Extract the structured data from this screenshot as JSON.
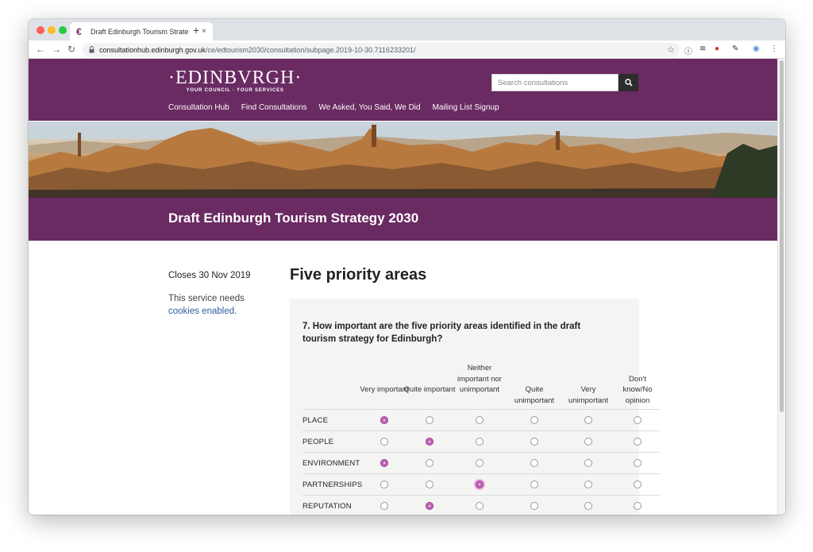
{
  "browser": {
    "tab_title": "Draft Edinburgh Tourism Strate",
    "tab_close": "×",
    "new_tab": "+",
    "url_host": "consultationhub.edinburgh.gov.uk",
    "url_path": "/ce/edtourism2030/consultation/subpage.2019-10-30.7116233201/"
  },
  "header": {
    "logo": "·EDINBVRGH·",
    "logo_tagline": "YOUR COUNCIL · YOUR SERVICES",
    "search_placeholder": "Search consultations",
    "nav": [
      "Consultation Hub",
      "Find Consultations",
      "We Asked, You Said, We Did",
      "Mailing List Signup"
    ]
  },
  "title_bar": {
    "title": "Draft Edinburgh Tourism Strategy 2030"
  },
  "sidebar": {
    "closes": "Closes 30 Nov 2019",
    "cookies_prefix": "This service needs",
    "cookies_link": "cookies enabled",
    "cookies_suffix": "."
  },
  "main": {
    "section_title": "Five priority areas",
    "question": "7. How important are the five priority areas identified in the draft tourism strategy for Edinburgh?",
    "columns": [
      "Very important",
      "Quite important",
      "Neither important nor unimportant",
      "Quite unimportant",
      "Very unimportant",
      "Don't know/No opinion"
    ],
    "rows": [
      {
        "label": "PLACE",
        "selected": 0
      },
      {
        "label": "PEOPLE",
        "selected": 1
      },
      {
        "label": "ENVIRONMENT",
        "selected": 0
      },
      {
        "label": "PARTNERSHIPS",
        "selected": 2
      },
      {
        "label": "REPUTATION",
        "selected": 1
      }
    ]
  },
  "colors": {
    "brand_purple": "#6a2a62",
    "radio_selected": "#b257a8"
  }
}
